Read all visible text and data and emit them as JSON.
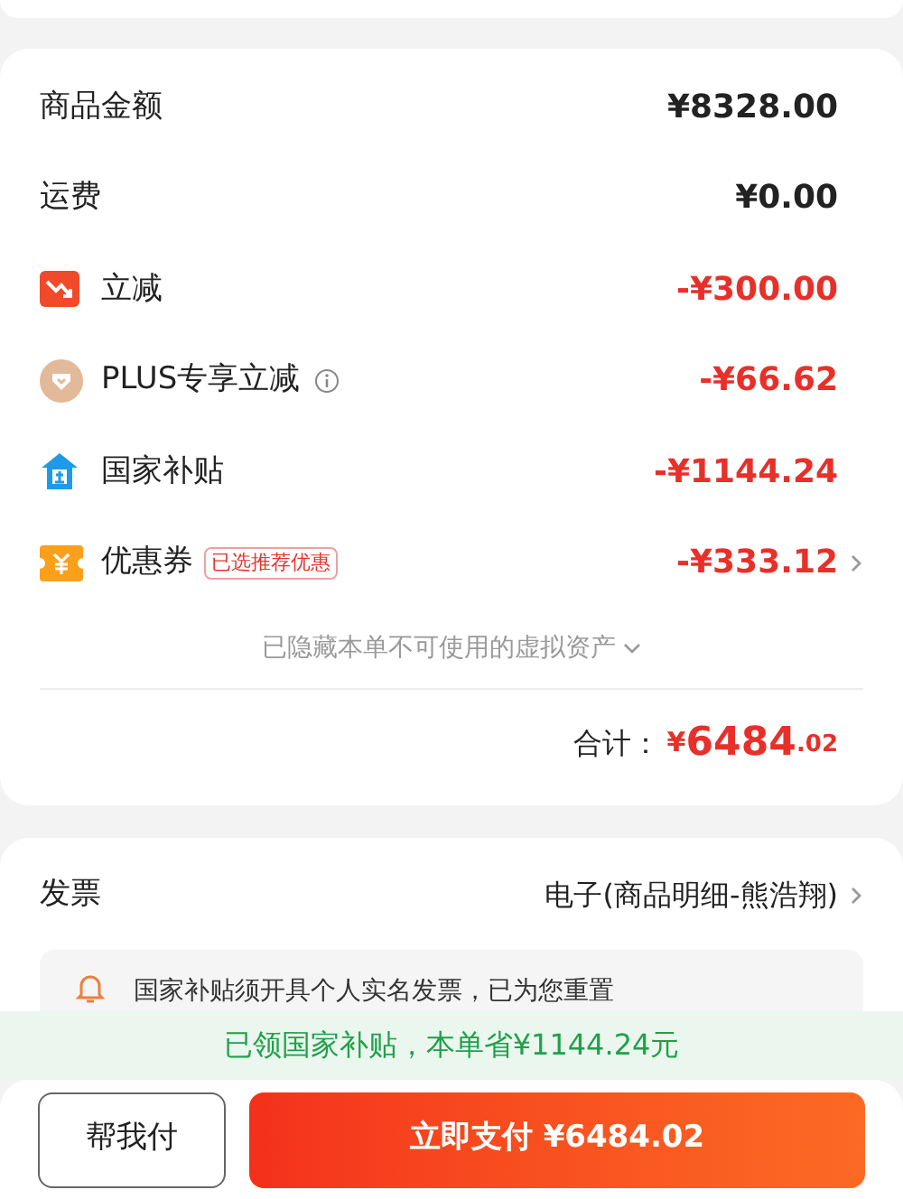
{
  "price_rows": [
    {
      "kind": "plain",
      "label": "商品金额",
      "amount": "¥8328.00",
      "negative": false,
      "info": false,
      "chevron": false
    },
    {
      "kind": "plain",
      "label": "运费",
      "amount": "¥0.00",
      "negative": false,
      "info": false,
      "chevron": false
    },
    {
      "kind": "instant",
      "label": "立减",
      "amount": "-¥300.00",
      "negative": true,
      "info": false,
      "chevron": false
    },
    {
      "kind": "member",
      "label": "PLUS专享立减",
      "amount": "-¥66.62",
      "negative": true,
      "info": true,
      "chevron": false
    },
    {
      "kind": "subsidy",
      "label": "国家补贴",
      "amount": "-¥1144.24",
      "negative": true,
      "info": false,
      "chevron": false
    },
    {
      "kind": "coupon",
      "label": "优惠券",
      "tag": "已选推荐优惠",
      "amount": "-¥333.12",
      "negative": true,
      "info": false,
      "chevron": true
    }
  ],
  "hidden_assets": "已隐藏本单不可使用的虚拟资产",
  "total": {
    "label": "合计：",
    "currency": "¥",
    "integer": "6484",
    "decimal": ".02"
  },
  "invoice": {
    "label": "发票",
    "value": "电子(商品明细-熊浩翔)",
    "notice": "国家补贴须开具个人实名发票，已为您重置"
  },
  "subsidy_banner": "已领国家补贴，本单省¥1144.24元",
  "actions": {
    "help_pay": "帮我付",
    "pay": "立即支付 ¥6484.02"
  }
}
